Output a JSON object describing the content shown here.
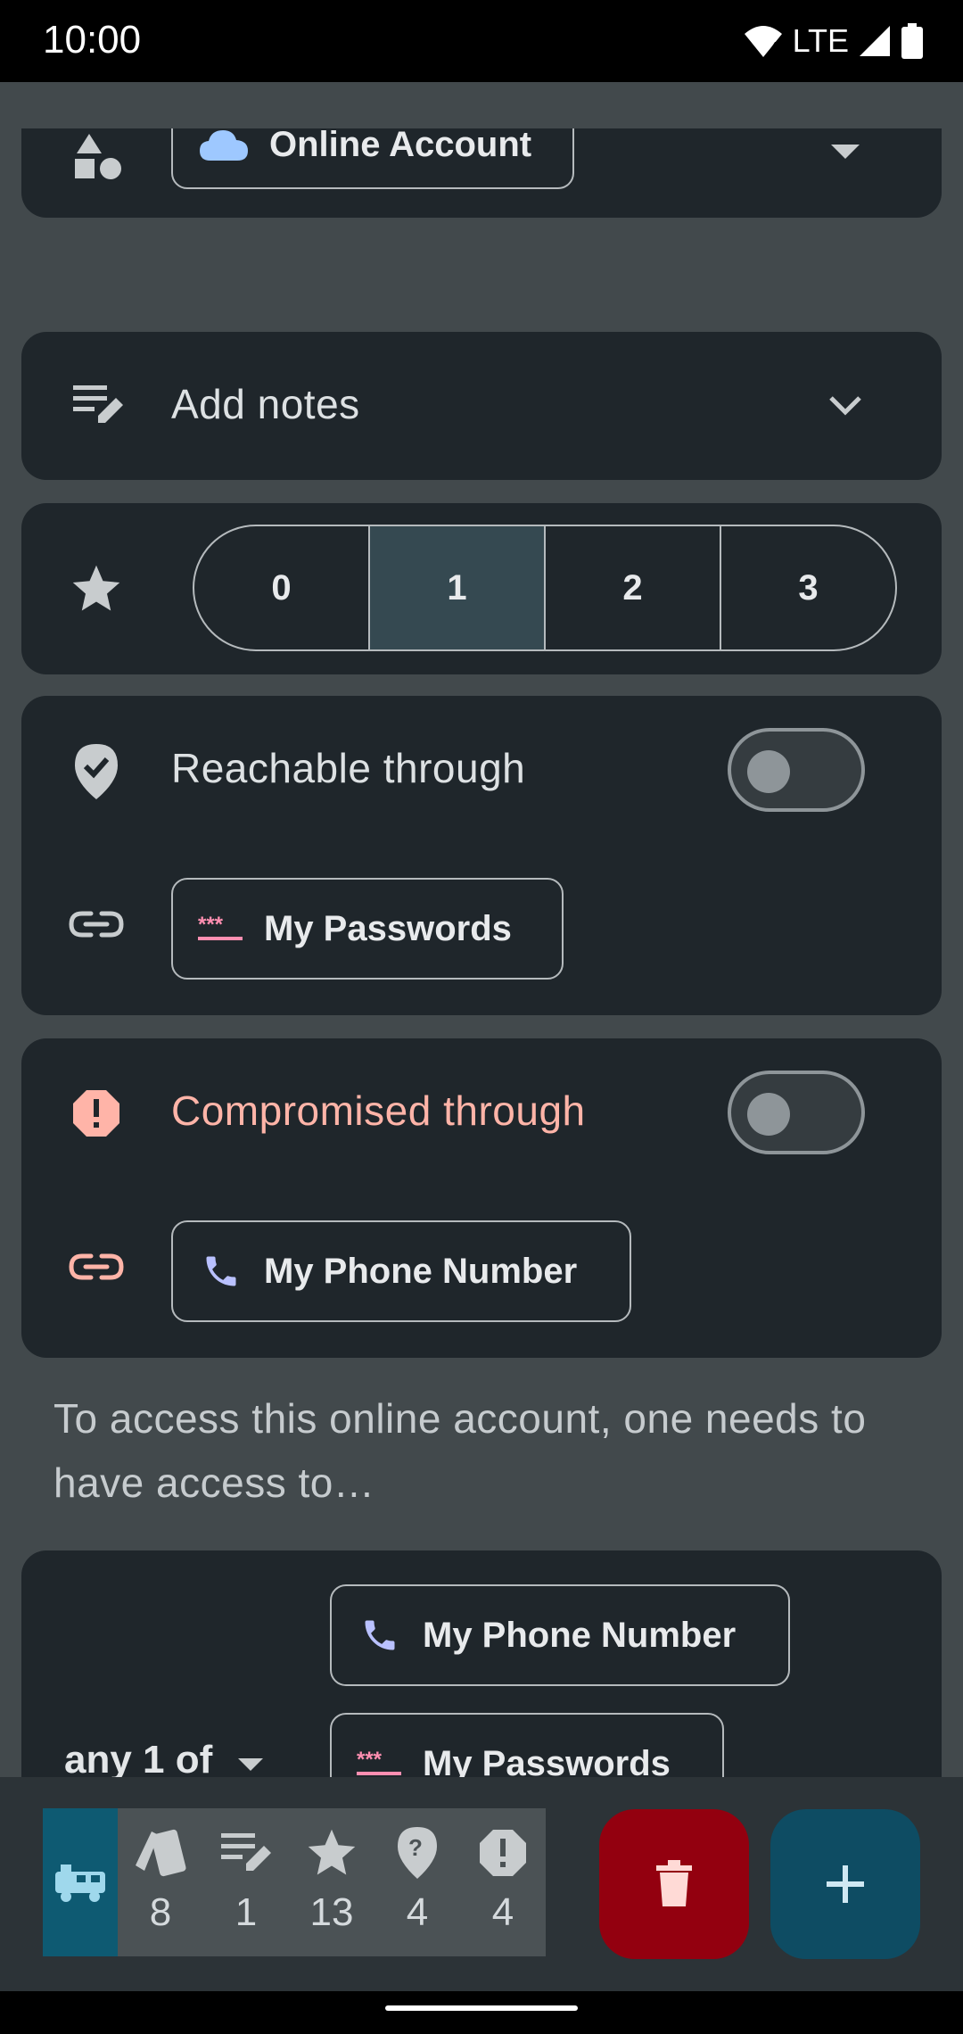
{
  "status_bar": {
    "time": "10:00",
    "network": "LTE"
  },
  "type_section": {
    "selected_type": "Online Account"
  },
  "notes_section": {
    "label": "Add notes"
  },
  "rating_section": {
    "options": [
      "0",
      "1",
      "2",
      "3"
    ],
    "selected": "1"
  },
  "reachable_section": {
    "label": "Reachable through",
    "toggle_on": false,
    "linked_chip": "My Passwords"
  },
  "compromised_section": {
    "label": "Compromised through",
    "toggle_on": false,
    "linked_chip": "My Phone Number"
  },
  "access_helper": "To access this online account, one needs to have access to…",
  "access_section": {
    "quantifier": "any 1 of",
    "items": [
      "My Phone Number",
      "My Passwords"
    ]
  },
  "bottom_bar": {
    "stats": [
      {
        "icon": "cards-icon",
        "value": "8"
      },
      {
        "icon": "notes-icon",
        "value": "1"
      },
      {
        "icon": "star-icon",
        "value": "13"
      },
      {
        "icon": "question-icon",
        "value": "4"
      },
      {
        "icon": "alert-icon",
        "value": "4"
      }
    ]
  },
  "colors": {
    "accent_teal": "#0e5a72",
    "delete_red": "#93000f",
    "compromised_pink": "#ffb4a8",
    "card_bg": "#1f262b"
  }
}
